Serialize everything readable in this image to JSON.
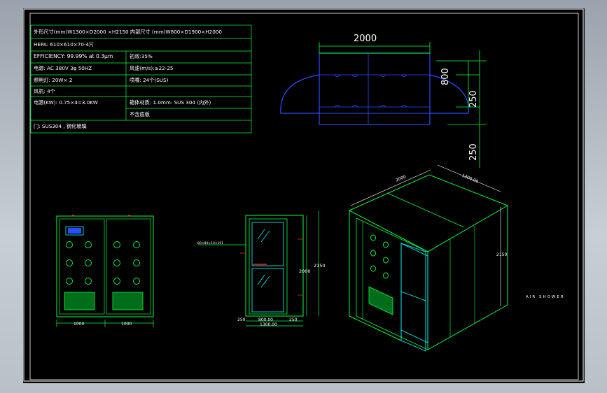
{
  "spec_table": {
    "rows": [
      {
        "left": "外形尺寸(mm)W1300×D2000 ×H2150  内部尺寸 (mm)W800×D1900×H2000",
        "right": ""
      },
      {
        "left": "HEPA: 610×610×70-4片",
        "right": ""
      },
      {
        "left": "EFFICIENCY: 99.99% at 0.3μm",
        "right": "初效:35%"
      },
      {
        "left": "电源: AC 380V 3φ  50HZ",
        "right": "风速(m/s):≥22-25"
      },
      {
        "left": "照明灯: 20W× 2",
        "right": "喷嘴: 24个(SUS)"
      },
      {
        "left": "风机: 4个",
        "right": ""
      },
      {
        "left": "电源(KW): 0.75×4=3.0KW",
        "right": "箱体材质: 1.0mm: SUS 304  (内外)"
      },
      {
        "left": "",
        "right": "不含底板"
      },
      {
        "left": "门: SUS304 , 钢化玻璃",
        "right": ""
      }
    ]
  },
  "top_view": {
    "width_dim": "2000",
    "dim_800": "800",
    "dim_250a": "250",
    "dim_250b": "250"
  },
  "front_view": {
    "dim_left": "1000",
    "dim_right": "1000"
  },
  "side_view": {
    "callout": "80×80×10×101",
    "dim_height_inner": "2000",
    "dim_height_outer": "2150",
    "dim_bottom_left": "250",
    "dim_bottom_mid": "800.00",
    "dim_bottom_right": "250",
    "dim_total": "1300.00"
  },
  "iso_view": {
    "dim_length": "2000",
    "dim_width": "1300.00",
    "dim_height": "2150",
    "caption": "AIR SHOWER"
  },
  "colors": {
    "line_green": "#00ff3c",
    "line_cyan": "#00ffff",
    "line_blue": "#2a4dff",
    "text_white": "#ffffff",
    "red_accent": "#ff2020"
  }
}
